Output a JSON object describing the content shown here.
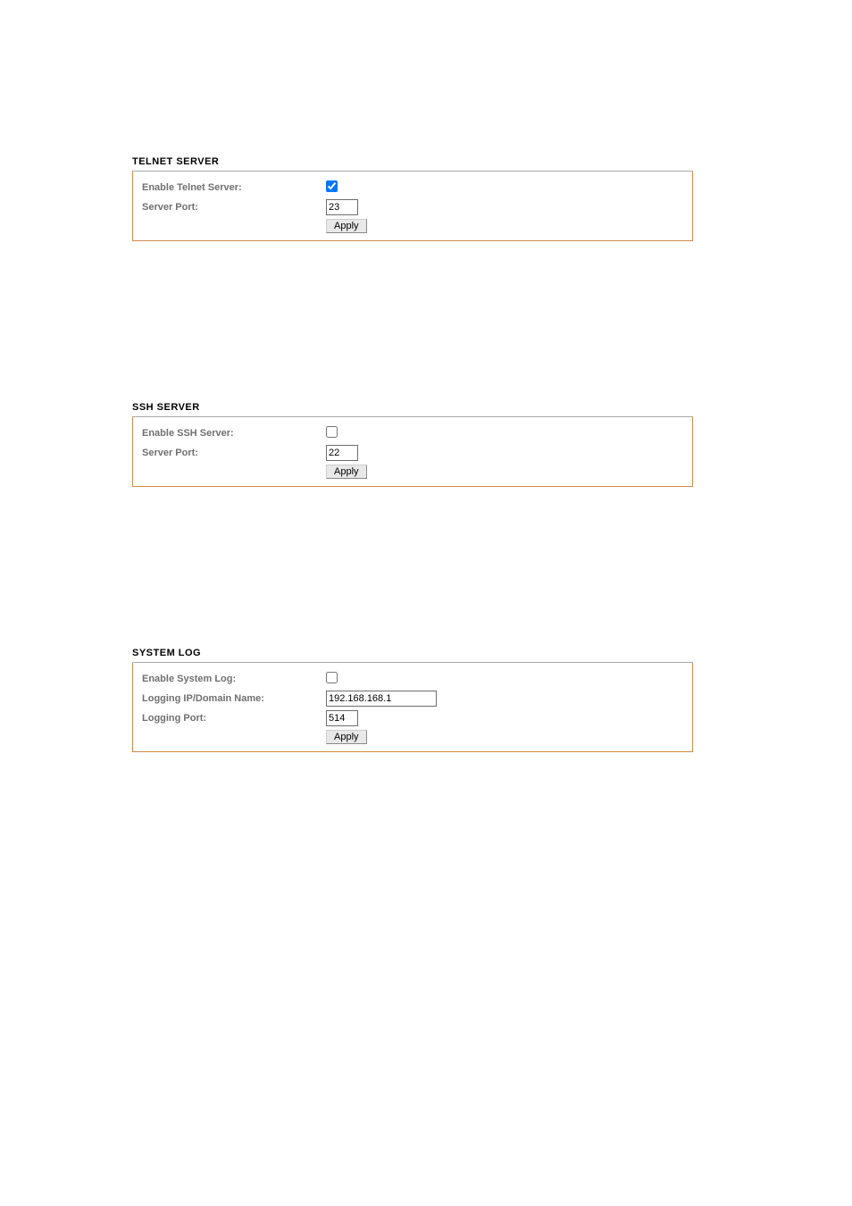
{
  "telnet": {
    "title": "TELNET SERVER",
    "enable_label": "Enable Telnet Server:",
    "enable_checked": true,
    "port_label": "Server Port:",
    "port_value": "23",
    "apply_label": "Apply"
  },
  "ssh": {
    "title": "SSH SERVER",
    "enable_label": "Enable SSH Server:",
    "enable_checked": false,
    "port_label": "Server Port:",
    "port_value": "22",
    "apply_label": "Apply"
  },
  "syslog": {
    "title": "SYSTEM LOG",
    "enable_label": "Enable System Log:",
    "enable_checked": false,
    "ip_label": "Logging IP/Domain Name:",
    "ip_value": "192.168.168.1",
    "port_label": "Logging Port:",
    "port_value": "514",
    "apply_label": "Apply"
  }
}
